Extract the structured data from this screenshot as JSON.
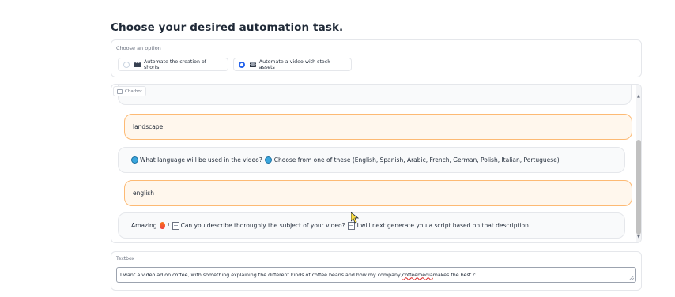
{
  "heading": "Choose your desired automation task.",
  "options": {
    "label": "Choose an option",
    "items": [
      {
        "label": "Automate the creation of shorts",
        "selected": false
      },
      {
        "label": "Automate a video with stock assets",
        "selected": true
      }
    ]
  },
  "chatbot": {
    "tag": "Chatbot",
    "messages": [
      {
        "role": "user",
        "text": "landscape"
      },
      {
        "role": "bot",
        "parts": [
          "What language will be used in the video?",
          "Choose from one of these (English, Spanish, Arabic, French, German, Polish, Italian, Portuguese)"
        ]
      },
      {
        "role": "user",
        "text": "english"
      },
      {
        "role": "bot",
        "parts": [
          "Amazing",
          "!",
          "Can you describe thoroughly the subject of your video?",
          "I will next generate you a script based on that description"
        ]
      }
    ]
  },
  "textbox": {
    "label": "Textbox",
    "value_before": "I want a video ad on coffee, with something explaining the different kinds of coffee beans and how my company, ",
    "value_spell": "coffeemedia",
    "value_after": " makes the best c"
  },
  "colors": {
    "accent": "#2563eb",
    "user_bubble_bg": "#fff7ed",
    "user_bubble_border": "#fdba74"
  },
  "icons": [
    "clapper-icon",
    "film-icon",
    "chat-icon",
    "globe-icon",
    "fire-icon",
    "memo-icon",
    "resize-handle-icon"
  ]
}
